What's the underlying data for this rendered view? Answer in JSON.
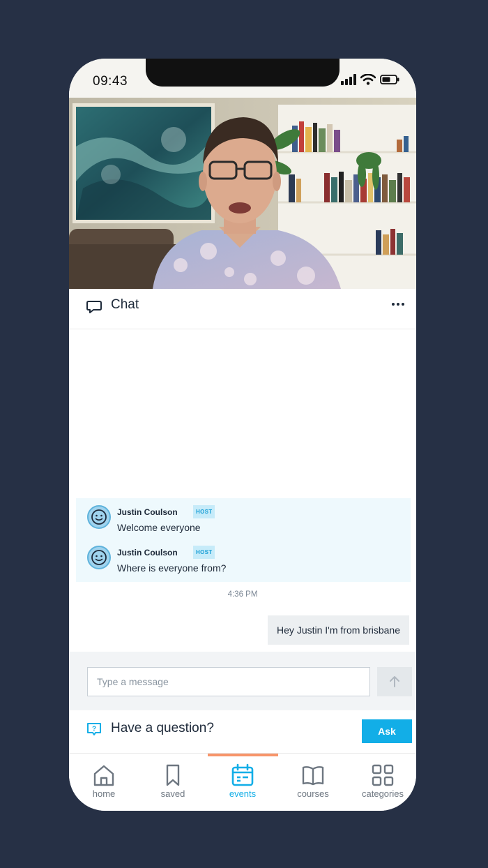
{
  "status_bar": {
    "time": "09:43"
  },
  "chat_header": {
    "title": "Chat"
  },
  "messages": [
    {
      "author": "Justin Coulson",
      "badge": "HOST",
      "text": "Welcome everyone"
    },
    {
      "author": "Justin Coulson",
      "badge": "HOST",
      "text": "Where is everyone from?"
    }
  ],
  "timestamp": "4:36 PM",
  "my_message": "Hey Justin I'm from brisbane",
  "composer": {
    "placeholder": "Type a message"
  },
  "question": {
    "label": "Have a question?",
    "button": "Ask"
  },
  "nav": {
    "items": [
      {
        "label": "home",
        "icon": "home-icon"
      },
      {
        "label": "saved",
        "icon": "bookmark-icon"
      },
      {
        "label": "events",
        "icon": "calendar-icon",
        "active": true
      },
      {
        "label": "courses",
        "icon": "book-icon"
      },
      {
        "label": "categories",
        "icon": "grid-icon"
      }
    ]
  },
  "colors": {
    "background": "#263045",
    "accent": "#12aee7",
    "active_indicator": "#f7956a",
    "host_highlight": "#eef9fd"
  }
}
